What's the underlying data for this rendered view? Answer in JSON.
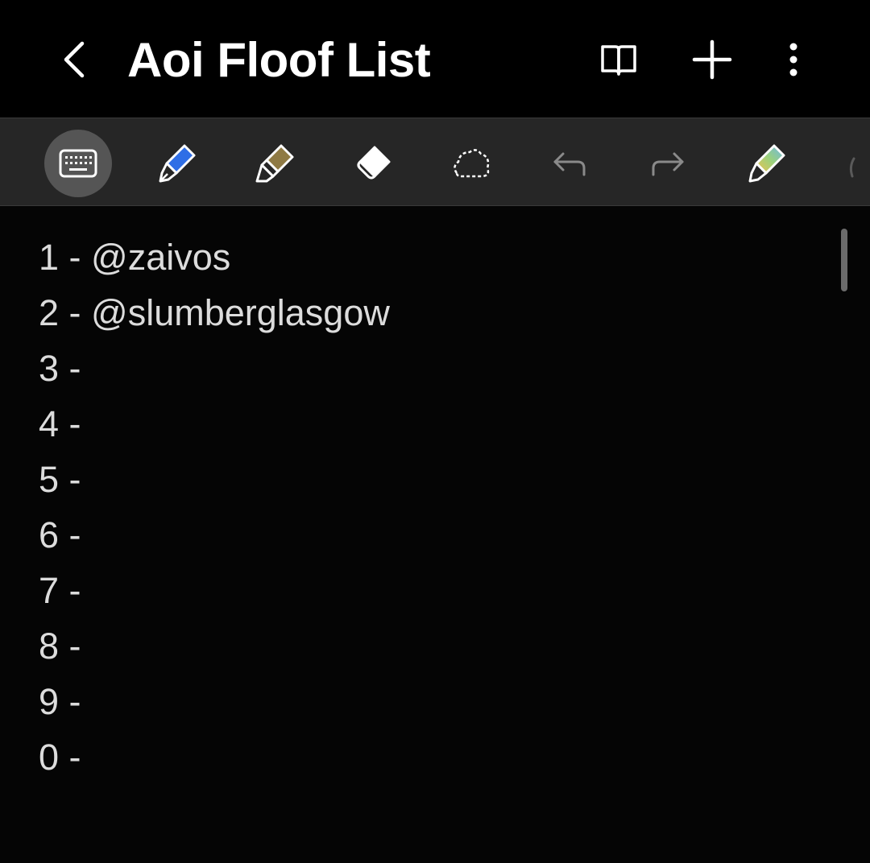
{
  "header": {
    "title": "Aoi Floof List",
    "icons": [
      "back-icon",
      "book-icon",
      "plus-icon",
      "more-vertical-icon"
    ]
  },
  "toolbar": {
    "tools": [
      {
        "name": "keyboard-icon",
        "active": true
      },
      {
        "name": "fountain-pen-icon",
        "color": "#2f6ee6"
      },
      {
        "name": "highlighter-icon",
        "color": "#8f7a44"
      },
      {
        "name": "eraser-icon"
      },
      {
        "name": "lasso-select-icon"
      },
      {
        "name": "undo-icon"
      },
      {
        "name": "redo-icon"
      },
      {
        "name": "rainbow-pen-icon"
      }
    ]
  },
  "note": {
    "lines": [
      "1 - @zaivos",
      "2 - @slumberglasgow",
      "3 -",
      "4 -",
      "5 -",
      "6 -",
      "7 -",
      "8 -",
      "9 -",
      "0 -"
    ]
  },
  "colors": {
    "background": "#050505",
    "toolbar": "#262626",
    "text": "#dcdcdc",
    "title": "#ffffff"
  }
}
